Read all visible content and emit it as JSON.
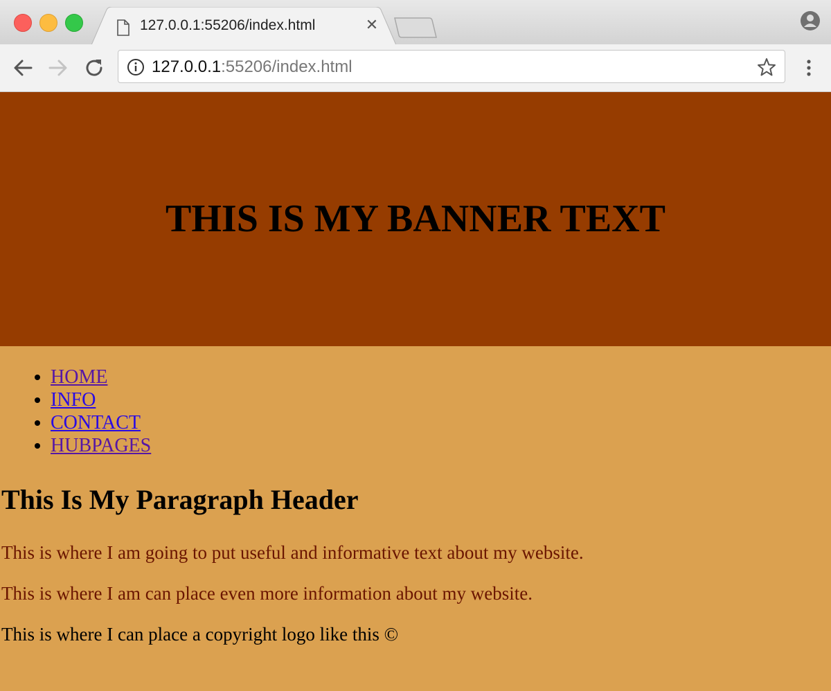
{
  "browser": {
    "tab_title": "127.0.0.1:55206/index.html",
    "url_host": "127.0.0.1",
    "url_rest": ":55206/index.html",
    "icons": [
      "close-icon",
      "back-icon",
      "forward-icon",
      "reload-icon",
      "info-icon",
      "star-icon",
      "menu-icon",
      "profile-icon",
      "page-icon"
    ]
  },
  "banner": {
    "text": "THIS IS MY BANNER TEXT",
    "color": "#963c00"
  },
  "nav": {
    "items": [
      {
        "label": "HOME"
      },
      {
        "label": "INFO"
      },
      {
        "label": "CONTACT"
      },
      {
        "label": "HUBPAGES"
      }
    ]
  },
  "content": {
    "header": "This Is My Paragraph Header",
    "paragraphs": [
      "This is where I am going to put useful and informative text about my website.",
      "This is where I am can place even more information about my website.",
      "This is where I can place a copyright logo like this ©"
    ],
    "background": "#dba150"
  }
}
